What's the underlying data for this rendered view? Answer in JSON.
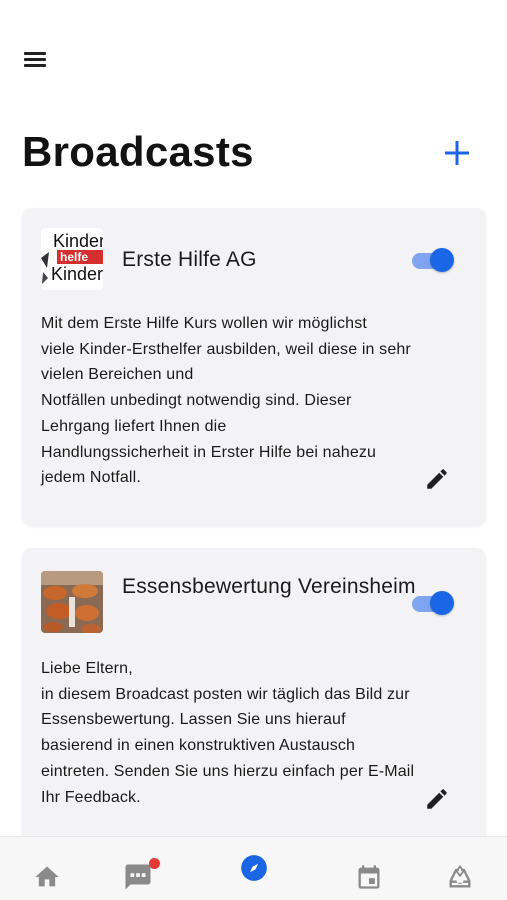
{
  "header": {
    "menu_icon": "hamburger-menu-icon",
    "title": "Broadcasts",
    "add_icon": "plus-icon",
    "accent_color": "#1a66e6"
  },
  "broadcasts": [
    {
      "title_lines": [
        "Erste Hilfe AG"
      ],
      "image_text": [
        "Kinder",
        "helfe",
        "Kinder"
      ],
      "enabled": true,
      "description_lines": [
        "Mit dem Erste Hilfe Kurs wollen wir möglichst",
        "viele Kinder-Ersthelfer ausbilden, weil diese in sehr",
        "vielen Bereichen und",
        "Notfällen unbedingt notwendig sind. Dieser",
        "Lehrgang liefert Ihnen die",
        "Handlungssicherheit in Erster Hilfe bei nahezu",
        "jedem Notfall."
      ],
      "edit_icon": "pencil-icon"
    },
    {
      "title_lines": [
        "Essensbewertung",
        "Vereinsheim"
      ],
      "enabled": true,
      "description_lines": [
        "Liebe Eltern,",
        "in diesem Broadcast posten wir täglich das Bild zur",
        "Essensbewertung. Lassen Sie uns hierauf",
        "basierend in einen konstruktiven Austausch",
        "eintreten. Senden Sie uns hierzu einfach per E-Mail",
        "Ihr Feedback."
      ],
      "edit_icon": "pencil-icon"
    }
  ],
  "bottom_nav": {
    "items": [
      {
        "icon": "home-icon",
        "active": false
      },
      {
        "icon": "chat-icon",
        "active": false,
        "has_notification": true
      },
      {
        "icon": "compass-icon",
        "active": true
      },
      {
        "icon": "calendar-icon",
        "active": false
      },
      {
        "icon": "inbox-icon",
        "active": false
      }
    ],
    "inactive_color": "#8a8a8a",
    "notification_color": "#e53935"
  }
}
